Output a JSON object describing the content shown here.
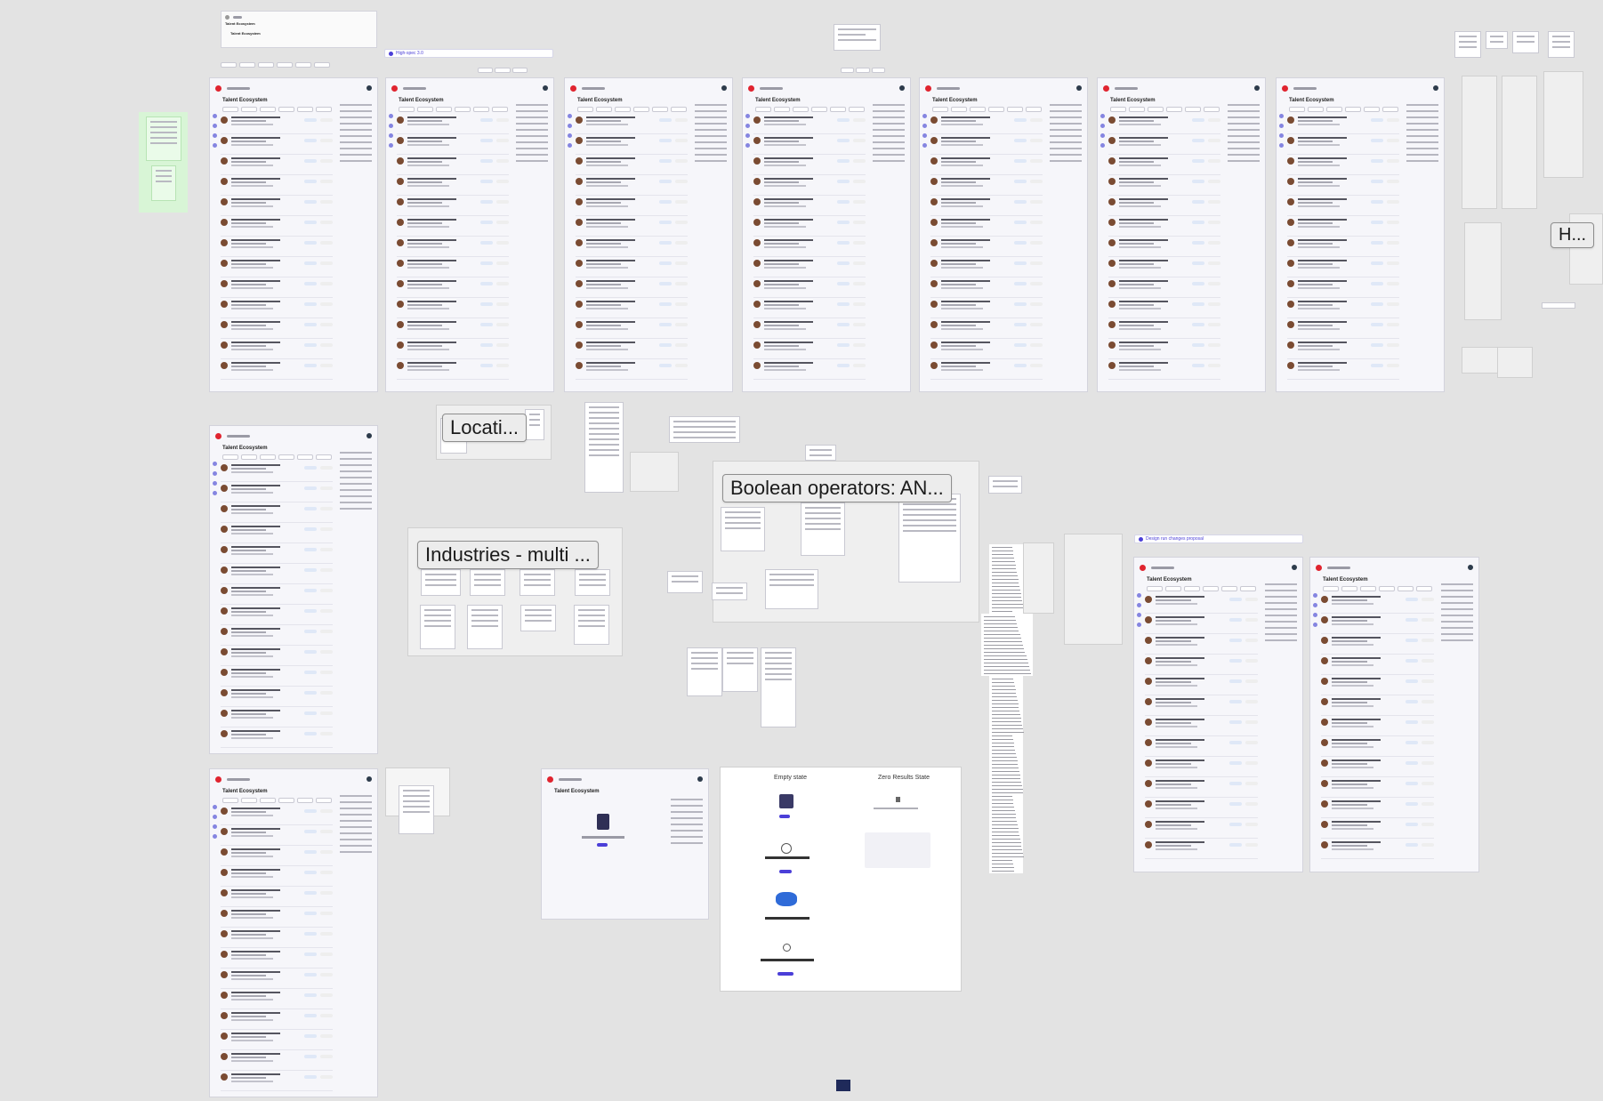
{
  "app": {
    "title": "Talent Ecosystem"
  },
  "frames_top": [
    "Talent Ecosystem",
    "Talent Ecosystem",
    "Talent Ecosystem",
    "Talent Ecosystem",
    "Talent Ecosystem",
    "Talent Ecosystem",
    "Talent Ecosystem"
  ],
  "frames_left": [
    "Talent Ecosystem",
    "Talent Ecosystem"
  ],
  "frame_empty_search": "Talent Ecosystem",
  "frames_right": [
    "Talent Ecosystem",
    "Talent Ecosystem"
  ],
  "header_card": {
    "title": "Talent Ecosystem",
    "subtitle": "Talent Ecosystem"
  },
  "banner_high": "High-spec 3.0",
  "banner_design": "Design run changes proposal",
  "callouts": {
    "location": "Locati...",
    "industries": "Industries - multi ...",
    "boolean": "Boolean operators: AN...",
    "h": "H..."
  },
  "states": {
    "empty": "Empty state",
    "zero": "Zero Results State"
  },
  "colors": {
    "canvas": "#e3e3e3",
    "accent": "#4b3fd8",
    "brand": "#e0242f",
    "sticky": "#d8f5d6"
  }
}
